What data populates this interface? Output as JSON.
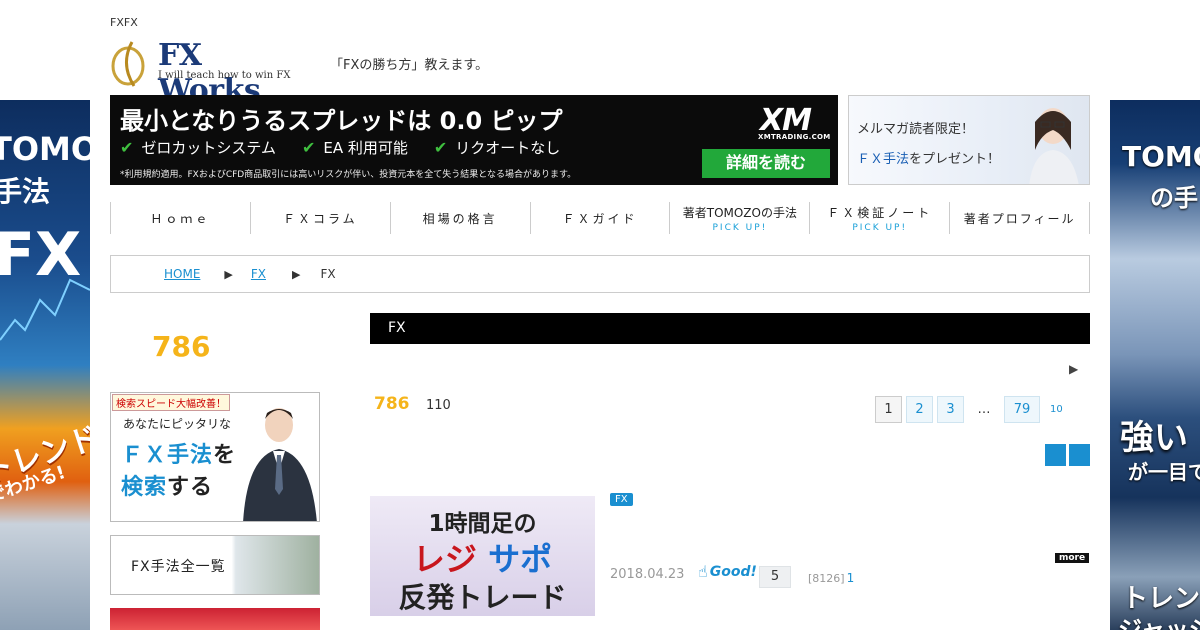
{
  "header": {
    "site_tag": "FXFX",
    "logo_title": "FX Works",
    "logo_sub": "I will teach how to win FX",
    "tagline": "「FXの勝ち方」教えます。"
  },
  "top_banner": {
    "headline": "最小となりうるスプレッドは 0.0 ピップ",
    "features": [
      "ゼロカットシステム",
      "EA 利用可能",
      "リクオートなし"
    ],
    "note": "*利用規約適用。FXおよびCFD商品取引には高いリスクが伴い、投資元本を全て失う結果となる場合があります。",
    "brand": "XM",
    "brand_sub": "XMTRADING.COM",
    "cta": "詳細を読む"
  },
  "promo": {
    "line1": "メルマガ読者限定！",
    "line2_highlight": "ＦＸ手法",
    "line2_rest": "をプレゼント！"
  },
  "nav": {
    "items": [
      {
        "label": "Ｈｏｍｅ",
        "pick": ""
      },
      {
        "label": "ＦＸコラム",
        "pick": ""
      },
      {
        "label": "相場の格言",
        "pick": ""
      },
      {
        "label": "ＦＸガイド",
        "pick": ""
      },
      {
        "label": "著者TOMOZOの手法",
        "pick": "PICK UP!"
      },
      {
        "label": "ＦＸ検証ノート",
        "pick": "PICK UP!"
      },
      {
        "label": "著者プロフィール",
        "pick": ""
      }
    ]
  },
  "breadcrumb": {
    "home": "HOME",
    "sep": "▶",
    "crumb2": "FX",
    "current": "FX"
  },
  "sidebar": {
    "count": "786",
    "ad_badge": "検索スピード大幅改善！",
    "ad_line1": "あなたにピッタリな",
    "ad_line2a": "ＦＸ手法",
    "ad_line2b": "を",
    "ad_line3a": "検索",
    "ad_line3b": "する",
    "list_ad": "FX手法全一覧"
  },
  "side_left": {
    "t1": "TOMOZO",
    "t2": "手法",
    "t3": "FX",
    "t4": "トレンド",
    "t5": "でわかる!"
  },
  "side_right": {
    "t1": "TOMOZ",
    "t2": "の手",
    "t3": "強い",
    "t4": "が一目で",
    "t5": "トレン",
    "t6": "ジャッジ"
  },
  "main": {
    "section_title": "FX",
    "next_arrow": "▶",
    "count_main": "786",
    "count_sub": "110",
    "pages": [
      "1",
      "2",
      "3",
      "…",
      "79",
      "10"
    ]
  },
  "article": {
    "thumb_l1": "1時間足の",
    "thumb_l2a": "レジ",
    "thumb_l2b": "サポ",
    "thumb_l3": "反発トレード",
    "tag": "FX",
    "more": "more",
    "date": "2018.04.23",
    "good_label": "Good!",
    "good_count": "5",
    "views": "[8126]",
    "views_extra": "1"
  },
  "colors": {
    "accent_blue": "#1a8fd0",
    "count_yellow": "#f5b41a",
    "cta_green": "#22a83a"
  }
}
